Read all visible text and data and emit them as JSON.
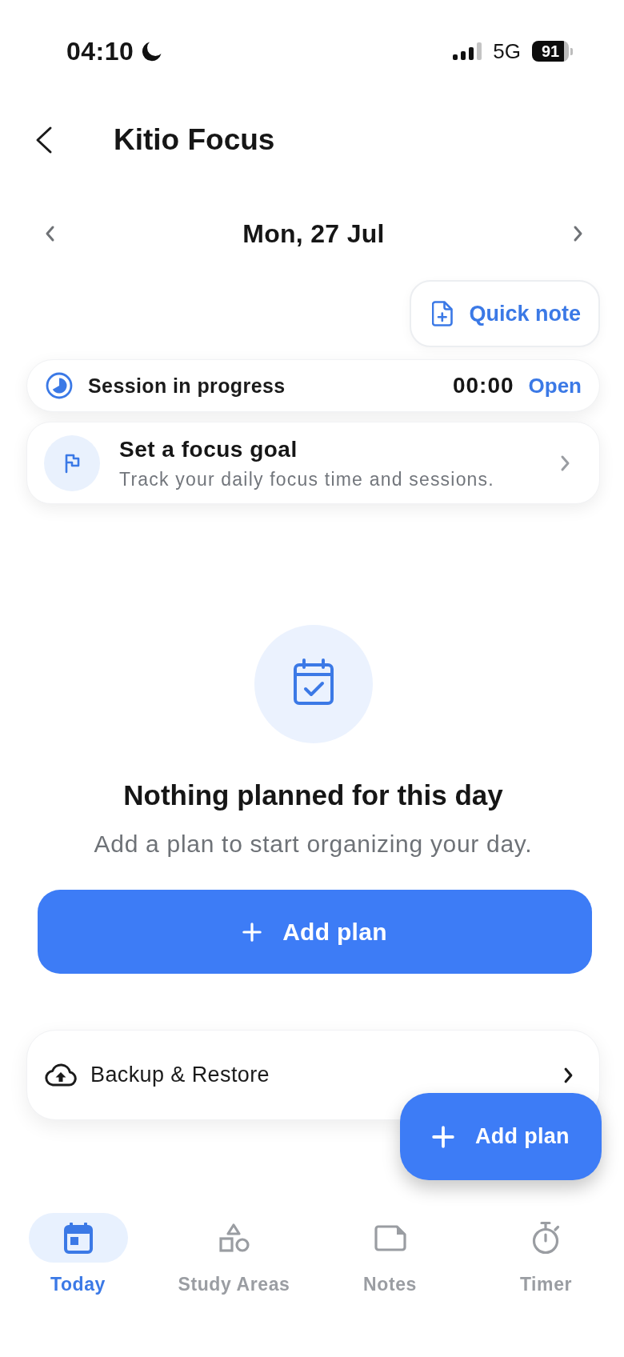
{
  "status_bar": {
    "time": "04:10",
    "network": "5G",
    "battery": "91"
  },
  "header": {
    "title": "Kitio Focus"
  },
  "date_nav": {
    "date": "Mon, 27 Jul"
  },
  "quick_note": {
    "label": "Quick note"
  },
  "session": {
    "label": "Session in progress",
    "elapsed": "00:00",
    "action": "Open"
  },
  "focus_goal": {
    "title": "Set a focus goal",
    "description": "Track your daily focus time and sessions."
  },
  "empty_state": {
    "title": "Nothing planned for this day",
    "message": "Add a plan to start organizing your day.",
    "button": "Add plan"
  },
  "backup": {
    "label": "Backup & Restore"
  },
  "fab": {
    "label": "Add plan"
  },
  "tabs": [
    {
      "label": "Today",
      "selected": true
    },
    {
      "label": "Study Areas",
      "selected": false
    },
    {
      "label": "Notes",
      "selected": false
    },
    {
      "label": "Timer",
      "selected": false
    }
  ]
}
